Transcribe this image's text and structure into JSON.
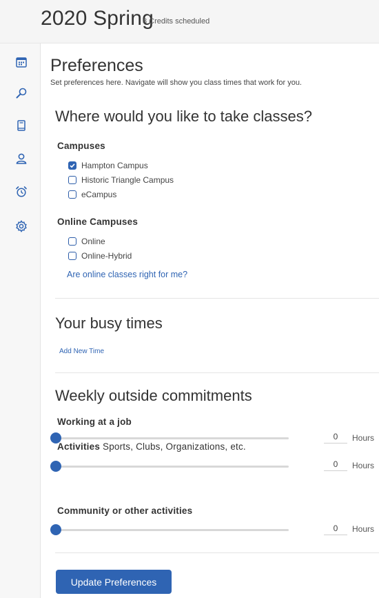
{
  "header": {
    "term": "2020 Spring",
    "credits": "8 Credits scheduled"
  },
  "sidebar": {
    "items": [
      {
        "icon": "calendar-icon"
      },
      {
        "icon": "search-icon"
      },
      {
        "icon": "book-icon"
      },
      {
        "icon": "user-icon"
      },
      {
        "icon": "alarm-clock-icon"
      },
      {
        "icon": "gear-icon"
      }
    ]
  },
  "preferences": {
    "title": "Preferences",
    "subtitle": "Set preferences here. Navigate will show you class times that work for you."
  },
  "location": {
    "title": "Where would you like to take classes?",
    "campuses_heading": "Campuses",
    "campuses": [
      {
        "label": "Hampton Campus",
        "checked": true
      },
      {
        "label": "Historic Triangle Campus",
        "checked": false
      },
      {
        "label": "eCampus",
        "checked": false
      }
    ],
    "online_heading": "Online Campuses",
    "online": [
      {
        "label": "Online",
        "checked": false
      },
      {
        "label": "Online-Hybrid",
        "checked": false
      }
    ],
    "online_link": "Are online classes right for me?"
  },
  "busy": {
    "title": "Your busy times",
    "add_link": "Add New Time"
  },
  "commitments": {
    "title": "Weekly outside commitments",
    "items": [
      {
        "label_bold": "Working at a job",
        "label_rest": "",
        "value": "0",
        "unit": "Hours",
        "level": 0
      },
      {
        "label_bold": "Activities",
        "label_rest": "Sports, Clubs, Organizations, etc.",
        "value": "0",
        "unit": "Hours",
        "level": 0
      },
      {
        "label_bold": "Community or other activities",
        "label_rest": "",
        "value": "0",
        "unit": "Hours",
        "level": 0
      }
    ]
  },
  "actions": {
    "update_label": "Update Preferences"
  },
  "colors": {
    "accent": "#2f64b3",
    "sidebar_bg": "#f7f7f7",
    "topbar_bg": "#f5f5f5"
  }
}
